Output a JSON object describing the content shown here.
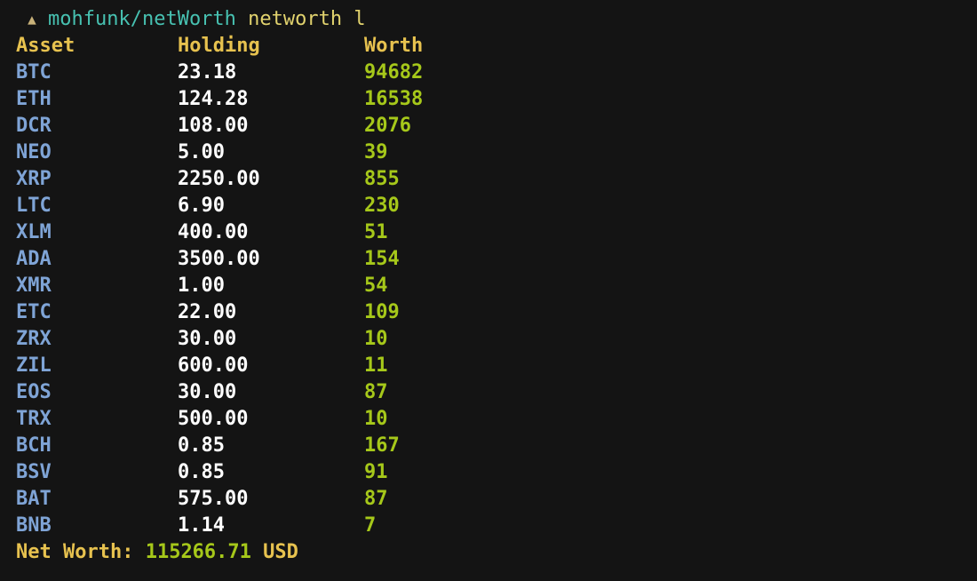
{
  "prompt": {
    "arrow": "▲",
    "path": "mohfunk/netWorth",
    "command": "networth l"
  },
  "table": {
    "headers": [
      "Asset",
      "Holding",
      "Worth"
    ],
    "rows": [
      {
        "asset": "BTC",
        "holding": "23.18",
        "worth": "94682"
      },
      {
        "asset": "ETH",
        "holding": "124.28",
        "worth": "16538"
      },
      {
        "asset": "DCR",
        "holding": "108.00",
        "worth": "2076"
      },
      {
        "asset": "NEO",
        "holding": "5.00",
        "worth": "39"
      },
      {
        "asset": "XRP",
        "holding": "2250.00",
        "worth": "855"
      },
      {
        "asset": "LTC",
        "holding": "6.90",
        "worth": "230"
      },
      {
        "asset": "XLM",
        "holding": "400.00",
        "worth": "51"
      },
      {
        "asset": "ADA",
        "holding": "3500.00",
        "worth": "154"
      },
      {
        "asset": "XMR",
        "holding": "1.00",
        "worth": "54"
      },
      {
        "asset": "ETC",
        "holding": "22.00",
        "worth": "109"
      },
      {
        "asset": "ZRX",
        "holding": "30.00",
        "worth": "10"
      },
      {
        "asset": "ZIL",
        "holding": "600.00",
        "worth": "11"
      },
      {
        "asset": "EOS",
        "holding": "30.00",
        "worth": "87"
      },
      {
        "asset": "TRX",
        "holding": "500.00",
        "worth": "10"
      },
      {
        "asset": "BCH",
        "holding": "0.85",
        "worth": "167"
      },
      {
        "asset": "BSV",
        "holding": "0.85",
        "worth": "91"
      },
      {
        "asset": "BAT",
        "holding": "575.00",
        "worth": "87"
      },
      {
        "asset": "BNB",
        "holding": "1.14",
        "worth": "7"
      }
    ]
  },
  "summary": {
    "label": "Net Worth:",
    "value": "115266.71",
    "unit": "USD"
  },
  "colors": {
    "background": "#141414",
    "header": "#e7c24f",
    "asset": "#7fa4d6",
    "holding": "#ffffff",
    "worth": "#a6c81a",
    "prompt_path": "#47c1b1",
    "prompt_command": "#e2d36e"
  }
}
